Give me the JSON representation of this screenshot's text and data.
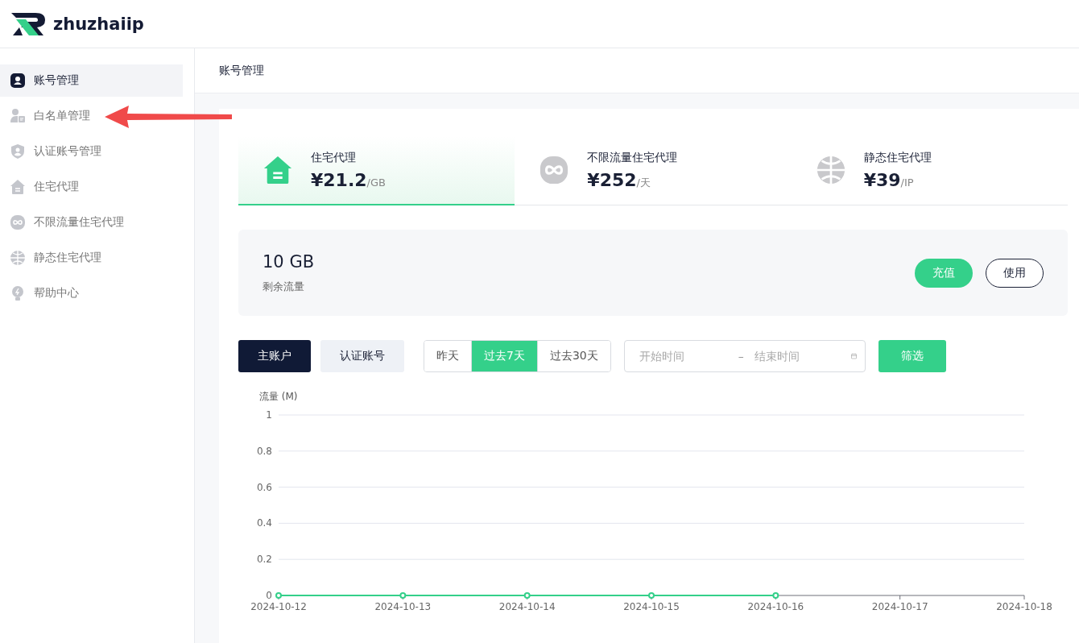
{
  "brand": {
    "name": "zhuzhaiip"
  },
  "sidebar": {
    "items": [
      {
        "label": "账号管理",
        "selected": true
      },
      {
        "label": "白名单管理",
        "selected": false
      },
      {
        "label": "认证账号管理",
        "selected": false
      },
      {
        "label": "住宅代理",
        "selected": false
      },
      {
        "label": "不限流量住宅代理",
        "selected": false
      },
      {
        "label": "静态住宅代理",
        "selected": false
      },
      {
        "label": "帮助中心",
        "selected": false
      }
    ]
  },
  "page_title": "账号管理",
  "products": [
    {
      "name": "住宅代理",
      "price": "¥21.2",
      "unit": "/GB",
      "selected": true
    },
    {
      "name": "不限流量住宅代理",
      "price": "¥252",
      "unit": "/天",
      "selected": false
    },
    {
      "name": "静态住宅代理",
      "price": "¥39",
      "unit": "/IP",
      "selected": false
    }
  ],
  "balance": {
    "value": "10 GB",
    "label": "剩余流量",
    "buttons": [
      {
        "label": "充值",
        "kind": "primary"
      },
      {
        "label": "使用",
        "kind": "outline"
      }
    ]
  },
  "account_tabs": [
    {
      "label": "主账户",
      "selected": true
    },
    {
      "label": "认证账号",
      "selected": false
    }
  ],
  "ranges": [
    {
      "label": "昨天",
      "selected": false
    },
    {
      "label": "过去7天",
      "selected": true
    },
    {
      "label": "过去30天",
      "selected": false
    }
  ],
  "date_range": {
    "start_placeholder": "开始时间",
    "separator": "–",
    "end_placeholder": "结束时间"
  },
  "filter_button": "筛选",
  "chart_data": {
    "type": "line",
    "ylabel": "流量 (M)",
    "categories": [
      "2024-10-12",
      "2024-10-13",
      "2024-10-14",
      "2024-10-15",
      "2024-10-16",
      "2024-10-17",
      "2024-10-18"
    ],
    "ylim": [
      0,
      1
    ],
    "grid": true,
    "yticks": [
      0,
      0.2,
      0.4,
      0.6,
      0.8,
      1
    ],
    "series": [
      {
        "color": "#34d08a",
        "marker": true,
        "values": [
          0,
          0,
          0,
          0,
          0,
          null,
          null
        ]
      }
    ]
  }
}
